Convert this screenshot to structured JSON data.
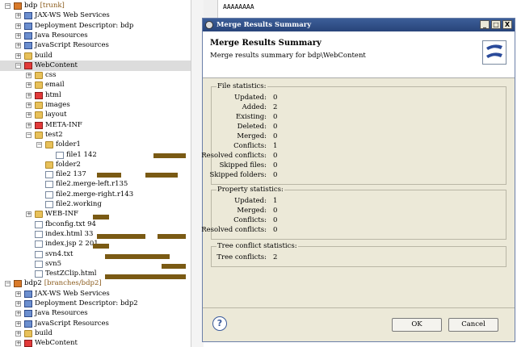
{
  "editor": {
    "line_text": "AAAAAAAA"
  },
  "tree": [
    {
      "indent": 0,
      "toggle": "−",
      "icon": "proj",
      "label": "bdp",
      "tag": "[trunk]"
    },
    {
      "indent": 1,
      "toggle": "+",
      "icon": "javaee",
      "label": "JAX-WS Web Services"
    },
    {
      "indent": 1,
      "toggle": "+",
      "icon": "javaee",
      "label": "Deployment Descriptor: bdp"
    },
    {
      "indent": 1,
      "toggle": "+",
      "icon": "javaee",
      "label": "Java Resources"
    },
    {
      "indent": 1,
      "toggle": "+",
      "icon": "javaee",
      "label": "JavaScript Resources"
    },
    {
      "indent": 1,
      "toggle": "+",
      "icon": "folder",
      "label": "build"
    },
    {
      "indent": 1,
      "toggle": "−",
      "icon": "conf",
      "label": "WebContent",
      "selected": true
    },
    {
      "indent": 2,
      "toggle": "+",
      "icon": "folder",
      "label": "css"
    },
    {
      "indent": 2,
      "toggle": "+",
      "icon": "folder",
      "label": "email"
    },
    {
      "indent": 2,
      "toggle": "+",
      "icon": "conf",
      "label": "html"
    },
    {
      "indent": 2,
      "toggle": "+",
      "icon": "folder",
      "label": "images"
    },
    {
      "indent": 2,
      "toggle": "+",
      "icon": "folder",
      "label": "layout"
    },
    {
      "indent": 2,
      "toggle": "+",
      "icon": "conf",
      "label": "META-INF"
    },
    {
      "indent": 2,
      "toggle": "−",
      "icon": "folder",
      "label": "test2"
    },
    {
      "indent": 3,
      "toggle": "−",
      "icon": "folder",
      "label": "folder1"
    },
    {
      "indent": 4,
      "toggle": "",
      "icon": "file",
      "label": "file1 142"
    },
    {
      "indent": 3,
      "toggle": "",
      "icon": "folder",
      "label": "folder2"
    },
    {
      "indent": 3,
      "toggle": "",
      "icon": "file",
      "label": "file2 137"
    },
    {
      "indent": 3,
      "toggle": "",
      "icon": "file",
      "label": "file2.merge-left.r135"
    },
    {
      "indent": 3,
      "toggle": "",
      "icon": "file",
      "label": "file2.merge-right.r143"
    },
    {
      "indent": 3,
      "toggle": "",
      "icon": "file",
      "label": "file2.working"
    },
    {
      "indent": 2,
      "toggle": "+",
      "icon": "folder",
      "label": "WEB-INF"
    },
    {
      "indent": 2,
      "toggle": "",
      "icon": "file",
      "label": "fbconfig.txt 94"
    },
    {
      "indent": 2,
      "toggle": "",
      "icon": "file",
      "label": "index.html 33"
    },
    {
      "indent": 2,
      "toggle": "",
      "icon": "file",
      "label": "index.jsp 2  201"
    },
    {
      "indent": 2,
      "toggle": "",
      "icon": "svn",
      "label": "svn4.txt"
    },
    {
      "indent": 2,
      "toggle": "",
      "icon": "svn",
      "label": "svn5"
    },
    {
      "indent": 2,
      "toggle": "",
      "icon": "file",
      "label": "TestZClip.html"
    },
    {
      "indent": 0,
      "toggle": "−",
      "icon": "proj",
      "label": "bdp2",
      "tag": "[branches/bdp2]"
    },
    {
      "indent": 1,
      "toggle": "+",
      "icon": "javaee",
      "label": "JAX-WS Web Services"
    },
    {
      "indent": 1,
      "toggle": "+",
      "icon": "javaee",
      "label": "Deployment Descriptor: bdp2"
    },
    {
      "indent": 1,
      "toggle": "+",
      "icon": "javaee",
      "label": "Java Resources"
    },
    {
      "indent": 1,
      "toggle": "+",
      "icon": "javaee",
      "label": "JavaScript Resources"
    },
    {
      "indent": 1,
      "toggle": "+",
      "icon": "folder",
      "label": "build"
    },
    {
      "indent": 1,
      "toggle": "+",
      "icon": "conf",
      "label": "WebContent"
    }
  ],
  "dialog": {
    "title": "Merge Results Summary",
    "header_title": "Merge Results Summary",
    "header_subtitle": "Merge results summary for bdp\\WebContent",
    "min_btn": "_",
    "max_btn": "□",
    "close_btn": "X",
    "groups": [
      {
        "label": "File statistics:",
        "rows": [
          {
            "k": "Updated:",
            "v": "0"
          },
          {
            "k": "Added:",
            "v": "2"
          },
          {
            "k": "Existing:",
            "v": "0"
          },
          {
            "k": "Deleted:",
            "v": "0"
          },
          {
            "k": "Merged:",
            "v": "0"
          },
          {
            "k": "Conflicts:",
            "v": "1"
          },
          {
            "k": "Resolved conflicts:",
            "v": "0"
          },
          {
            "k": "Skipped files:",
            "v": "0"
          },
          {
            "k": "Skipped folders:",
            "v": "0"
          }
        ]
      },
      {
        "label": "Property statistics:",
        "rows": [
          {
            "k": "Updated:",
            "v": "1"
          },
          {
            "k": "Merged:",
            "v": "0"
          },
          {
            "k": "Conflicts:",
            "v": "0"
          },
          {
            "k": "Resolved conflicts:",
            "v": "0"
          }
        ]
      },
      {
        "label": "Tree conflict statistics:",
        "rows": [
          {
            "k": "Tree conflicts:",
            "v": "2"
          }
        ]
      }
    ],
    "help_icon": "?",
    "ok_label": "OK",
    "cancel_label": "Cancel"
  }
}
